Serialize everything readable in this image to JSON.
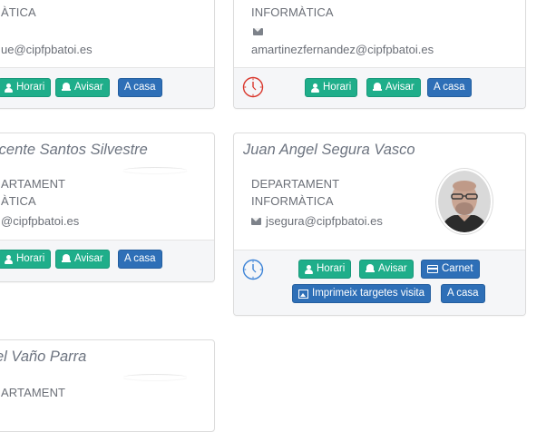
{
  "cards": {
    "top_left": {
      "dept_line": "ÀTICA",
      "email": "ue@cipfpbatoi.es",
      "buttons": {
        "horari": "Horari",
        "avisar": "Avisar",
        "a_casa": "A casa"
      }
    },
    "top_right": {
      "dept_line": "INFORMÀTICA",
      "email": "amartinezfernandez@cipfpbatoi.es",
      "buttons": {
        "horari": "Horari",
        "avisar": "Avisar",
        "a_casa": "A casa"
      }
    },
    "mid_left": {
      "name": "icente Santos Silvestre",
      "dept_line1": "ARTAMENT",
      "dept_line2": "ÀTICA",
      "email": "@cipfpbatoi.es",
      "buttons": {
        "horari": "Horari",
        "avisar": "Avisar",
        "a_casa": "A casa"
      }
    },
    "mid_right": {
      "name": "Juan Angel Segura Vasco",
      "dept_line1": "DEPARTAMENT",
      "dept_line2": "INFORMÀTICA",
      "email": "jsegura@cipfpbatoi.es",
      "buttons": {
        "horari": "Horari",
        "avisar": "Avisar",
        "carnet": "Carnet",
        "imprimeix": "Imprimeix targetes visita",
        "a_casa": "A casa"
      }
    },
    "bottom_left": {
      "name": "el Vaño Parra",
      "dept_line1": "ARTAMENT"
    }
  },
  "colors": {
    "green_button": "#1fae8a",
    "blue_button": "#2e6fb7",
    "clock_red": "#d9362b",
    "clock_blue": "#3b82d6"
  },
  "icons": {
    "user": "user-icon",
    "bell": "bell-icon",
    "card": "id-card-icon",
    "picture": "picture-icon",
    "envelope": "envelope-icon",
    "clock": "clock-icon"
  }
}
